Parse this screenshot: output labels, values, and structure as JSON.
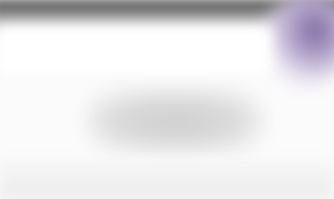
{
  "colors": {
    "background": "#fbfbfb",
    "top_bar": "#4a4a4a",
    "corner_accent": "#7a6aa0",
    "center_card": "#cfcfcf"
  }
}
